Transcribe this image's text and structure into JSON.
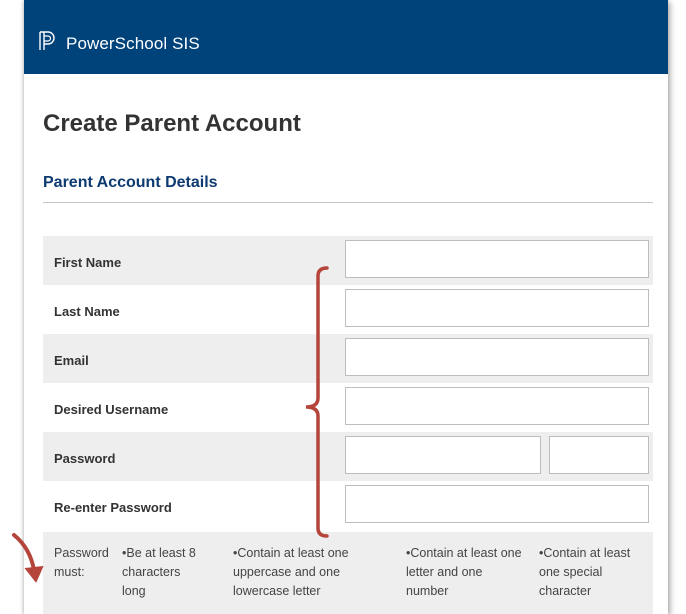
{
  "app": {
    "brand": "PowerSchool SIS"
  },
  "page": {
    "title": "Create Parent Account",
    "section_title": "Parent Account Details"
  },
  "form": {
    "fields": [
      {
        "label": "First Name",
        "value": ""
      },
      {
        "label": "Last Name",
        "value": ""
      },
      {
        "label": "Email",
        "value": ""
      },
      {
        "label": "Desired Username",
        "value": ""
      },
      {
        "label": "Password",
        "value": ""
      },
      {
        "label": "Re-enter Password",
        "value": ""
      }
    ]
  },
  "password_rules": {
    "lead": "Password must:",
    "rules": [
      "•Be at least 8 characters long",
      "•Contain at least one uppercase and one lowercase letter",
      "•Contain at least one letter and one number",
      "•Contain at least one special character"
    ]
  },
  "colors": {
    "header_bg": "#00427a",
    "section_title": "#0d3a70",
    "row_shade": "#eeeeee",
    "annotation": "#b5443b"
  }
}
